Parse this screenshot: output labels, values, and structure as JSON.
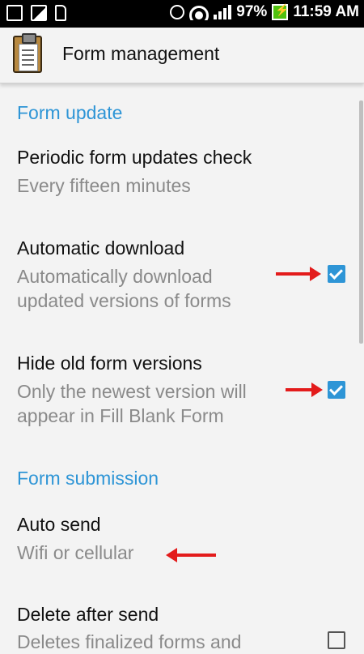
{
  "status_bar": {
    "battery": "97%",
    "time": "11:59 AM",
    "icons": [
      "mail-icon",
      "image-icon",
      "sd-card-icon",
      "alarm-icon",
      "wifi-icon",
      "signal-icon",
      "battery-charging-icon"
    ]
  },
  "toolbar": {
    "title": "Form management",
    "icon": "clipboard-icon"
  },
  "sections": {
    "form_update": {
      "label": "Form update",
      "periodic": {
        "title": "Periodic form updates check",
        "summary": "Every fifteen minutes"
      },
      "auto_download": {
        "title": "Automatic download",
        "summary": "Automatically download updated versions of forms",
        "checked": true
      },
      "hide_old": {
        "title": "Hide old form versions",
        "summary": "Only the newest version will appear in Fill Blank Form",
        "checked": true
      }
    },
    "form_submission": {
      "label": "Form submission",
      "auto_send": {
        "title": "Auto send",
        "summary": "Wifi or cellular"
      },
      "delete_after_send": {
        "title": "Delete after send",
        "summary": "Deletes finalized forms and",
        "checked": false
      }
    }
  },
  "colors": {
    "accent": "#2e95d6",
    "arrow": "#e31b1b"
  }
}
